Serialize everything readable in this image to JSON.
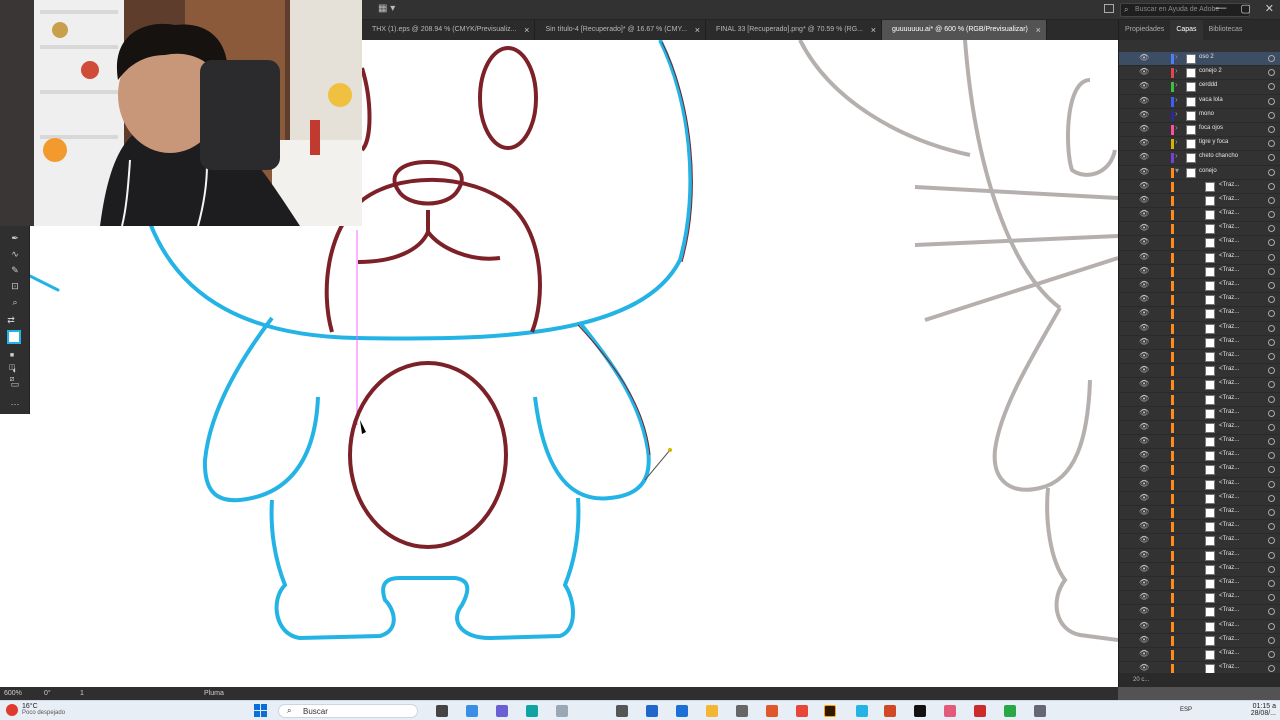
{
  "tabs": [
    {
      "label": "THX (1).eps @ 208.94 % (CMYK/Previsualiz...",
      "active": false
    },
    {
      "label": "Sin título-4 [Recuperado]* @ 16.67 % (CMY...",
      "active": false
    },
    {
      "label": "FINAL 33 [Recuperado].png* @ 70.59 % (RG...",
      "active": false
    },
    {
      "label": "guuuuuuu.ai* @ 600 % (RGB/Previsualizar)",
      "active": true
    }
  ],
  "tab_close": "×",
  "search_help": {
    "placeholder": "Buscar en Ayuda de Adobe"
  },
  "right_panel": {
    "tabs": [
      "Propiedades",
      "Capas",
      "Bibliotecas"
    ],
    "active_tab": "Capas",
    "layers": [
      {
        "name": "oso 2",
        "color": "#4a7fff",
        "expanded": false,
        "selected": true
      },
      {
        "name": "conejo 2",
        "color": "#e24646",
        "expanded": false
      },
      {
        "name": "cerddd",
        "color": "#3fbf3f",
        "expanded": false
      },
      {
        "name": "vaca lola",
        "color": "#3a5fff",
        "expanded": false
      },
      {
        "name": "mono",
        "color": "#2a2a9c",
        "expanded": false
      },
      {
        "name": "foca ojos",
        "color": "#ff4fa0",
        "expanded": false
      },
      {
        "name": "tigre y foca",
        "color": "#d4b400",
        "expanded": false
      },
      {
        "name": "cheto chancho",
        "color": "#7a3fd6",
        "expanded": false
      },
      {
        "name": "conejo",
        "color": "#ff8c1a",
        "expanded": true
      }
    ],
    "sublayer_label": "<Traz...",
    "sublayer_count": 35,
    "footer": "20 c..."
  },
  "status": {
    "zoom": "600%",
    "angle": "0°",
    "artboard": "1",
    "tool": "Pluma"
  },
  "taskbar": {
    "weather_temp": "16°C",
    "weather_desc": "Poco despejado",
    "search_label": "Buscar",
    "lang": "ESP",
    "time": "01:15 a",
    "date": "28/08/..."
  },
  "colors": {
    "cyan": "#23b3e4",
    "maroon": "#7d2128",
    "gray": "#b5b0ae",
    "guide": "#ff66ff"
  }
}
